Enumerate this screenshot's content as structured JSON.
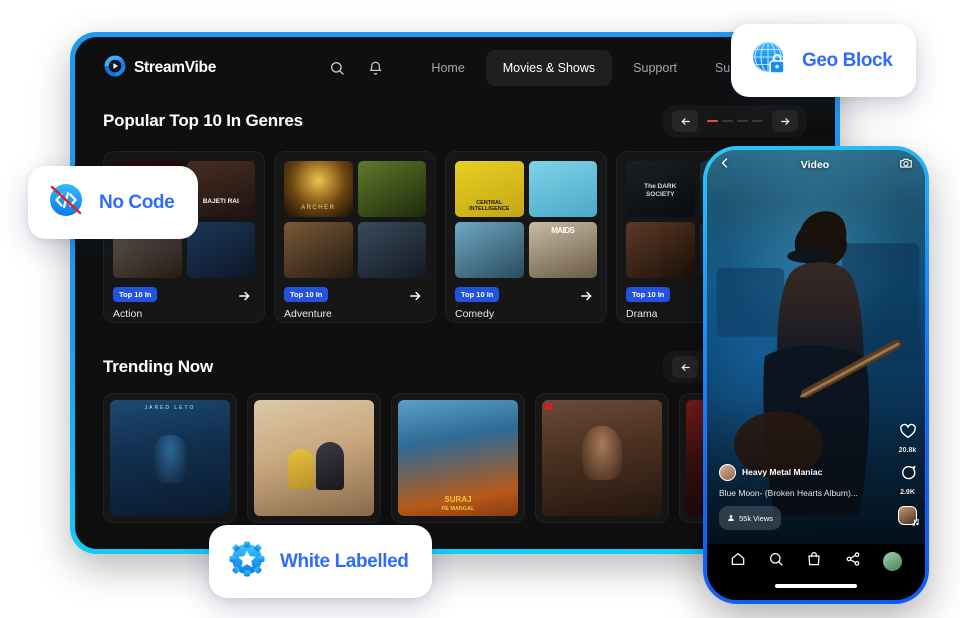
{
  "tv": {
    "brand": {
      "name": "StreamVibe",
      "logo_icon": "play-circle-logo-icon"
    },
    "header_icons": [
      {
        "name": "search-icon"
      },
      {
        "name": "bell-icon"
      }
    ],
    "nav_links": [
      {
        "label": "Home",
        "active": false
      },
      {
        "label": "Movies & Shows",
        "active": true
      },
      {
        "label": "Support",
        "active": false
      },
      {
        "label": "Subscriptions",
        "active": false
      }
    ],
    "sections": [
      {
        "title": "Popular Top 10 In Genres",
        "carousel": {
          "prev_icon": "arrow-left-icon",
          "next_icon": "arrow-right-icon",
          "dots_total": 4,
          "dot_active_index": 0,
          "active_color": "#e0542a"
        },
        "genres": [
          {
            "badge": "Top 10 In",
            "name": "Action",
            "arrow_icon": "arrow-right-icon"
          },
          {
            "badge": "Top 10 In",
            "name": "Adventure",
            "arrow_icon": "arrow-right-icon"
          },
          {
            "badge": "Top 10 In",
            "name": "Comedy",
            "arrow_icon": "arrow-right-icon"
          },
          {
            "badge": "Top 10 In",
            "name": "Drama",
            "arrow_icon": "arrow-right-icon"
          }
        ]
      },
      {
        "title": "Trending Now",
        "carousel": {
          "prev_icon": "arrow-left-icon",
          "next_icon": "arrow-right-icon"
        },
        "posters_count": 5
      }
    ]
  },
  "pills": [
    {
      "id": "no-code",
      "label": "No Code",
      "icon": "code-slash-blocked-icon",
      "text_color": "#2f6bff"
    },
    {
      "id": "geo-block",
      "label": "Geo Block",
      "icon": "globe-lock-icon",
      "text_color": "#2f6bff"
    },
    {
      "id": "white-labelled",
      "label": "White Labelled",
      "icon": "star-badge-icon",
      "text_color": "#2f6bff"
    }
  ],
  "phone": {
    "header": {
      "back_icon": "chevron-left-icon",
      "title": "Video",
      "camera_icon": "camera-icon"
    },
    "reactions": [
      {
        "icon": "heart-icon",
        "count": "20.8k"
      },
      {
        "icon": "comment-icon",
        "count": "2.9K"
      },
      {
        "icon": "audio-profile-icon",
        "count": ""
      }
    ],
    "video": {
      "author": "Heavy Metal Maniac",
      "title": "Blue Moon- (Broken Hearts Album)...",
      "views": "55k Views",
      "views_icon": "person-icon",
      "avatar_icon": "avatar"
    },
    "bottom_nav": [
      {
        "icon": "home-icon"
      },
      {
        "icon": "search-icon"
      },
      {
        "icon": "shopping-bag-icon"
      },
      {
        "icon": "share-icon"
      },
      {
        "icon": "profile-avatar"
      }
    ]
  },
  "theme": {
    "frame_border": "#1e9bf0",
    "frame_border_bottom": "#0ad4ff",
    "screen_bg": "#0f0f0f",
    "card_bg": "#161616",
    "badge_blue": "#2253e0",
    "accent_orange": "#e0542a"
  }
}
